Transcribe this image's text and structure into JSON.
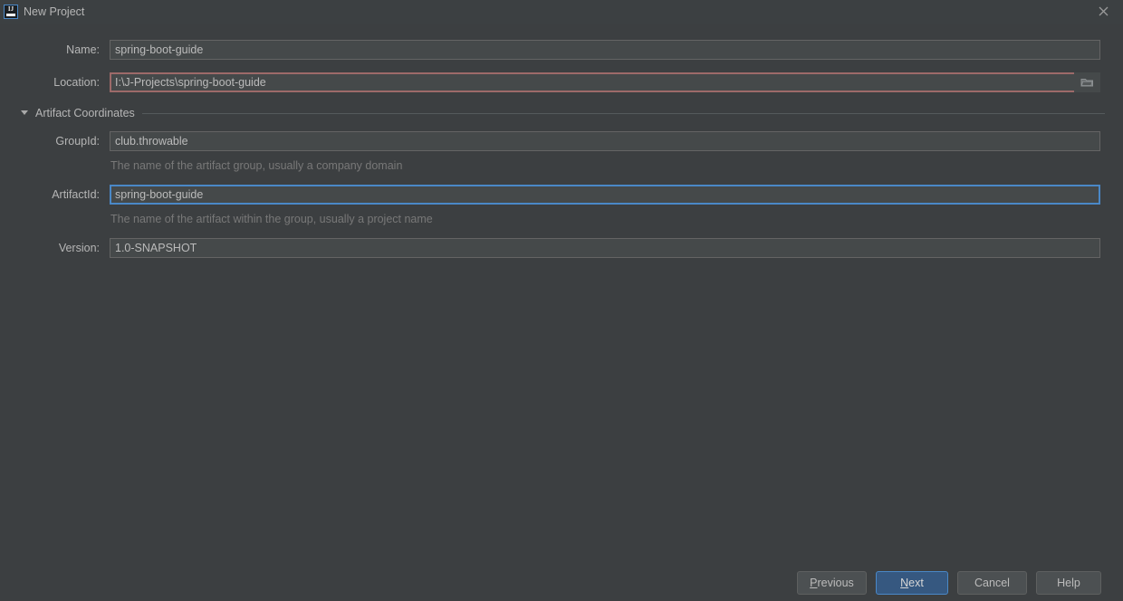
{
  "window": {
    "title": "New Project",
    "app_icon": "intellij-idea-logo",
    "close_icon": "close-icon",
    "bg_color": "#3c3f41",
    "titlebar_color": "#3c4042"
  },
  "form": {
    "fields": [
      {
        "key": "name",
        "label": "Name:",
        "value": "spring-boot-guide",
        "state": "normal",
        "hint": null
      },
      {
        "key": "location",
        "label": "Location:",
        "value": "I:\\J-Projects\\spring-boot-guide",
        "state": "warning",
        "hint": null,
        "browse_icon": "folder-icon"
      }
    ]
  },
  "section": {
    "label": "Artifact Coordinates",
    "expanded": true,
    "toggle_icon": "triangle-down-icon",
    "fields": [
      {
        "key": "group_id",
        "label": "GroupId:",
        "value": "club.throwable",
        "state": "normal",
        "hint": "The name of the artifact group, usually a company domain"
      },
      {
        "key": "artifact_id",
        "label": "ArtifactId:",
        "value": "spring-boot-guide",
        "state": "focused",
        "hint": "The name of the artifact within the group, usually a project name"
      },
      {
        "key": "version",
        "label": "Version:",
        "value": "1.0-SNAPSHOT",
        "state": "normal",
        "hint": null
      }
    ]
  },
  "buttons": {
    "previous": {
      "label_before": "",
      "mnemonic": "P",
      "label_after": "revious"
    },
    "next": {
      "label_before": "",
      "mnemonic": "N",
      "label_after": "ext",
      "primary": true
    },
    "cancel": {
      "label": "Cancel"
    },
    "help": {
      "label": "Help"
    }
  },
  "colors": {
    "accent": "#4a88c7",
    "primary_button": "#365880",
    "warning_border": "#9d6a69",
    "input_bg": "#45494a",
    "hint_text": "#787878"
  }
}
